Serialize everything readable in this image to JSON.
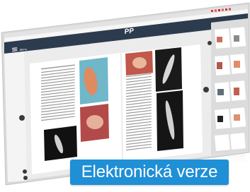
{
  "header": {
    "menu_label": "Menu"
  },
  "caption": {
    "text": "Elektronická verze"
  },
  "colors": {
    "caption_background": "#1f8fd6",
    "header_bar": "#2d3b4e",
    "screen_background": "#ececec",
    "sidebar_background": "#dcdcdc"
  }
}
